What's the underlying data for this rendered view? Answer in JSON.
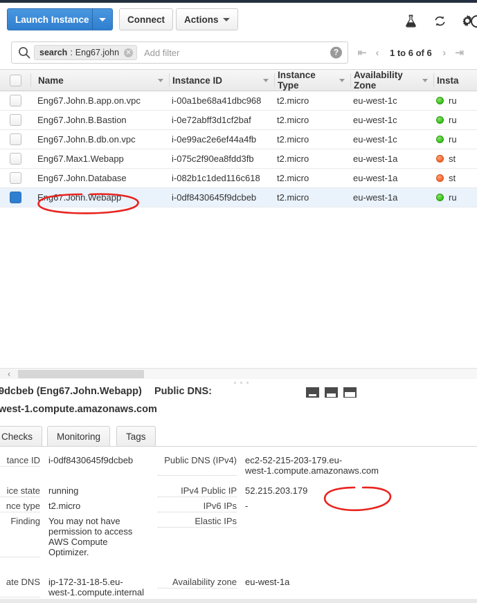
{
  "toolbar": {
    "launch_label": "Launch Instance",
    "launch_caret_icon": "caret-down-icon",
    "connect_label": "Connect",
    "actions_label": "Actions",
    "icons": [
      "flask-icon",
      "refresh-icon",
      "gear-icon",
      "help-circle-icon"
    ]
  },
  "filter": {
    "search_icon": "search-icon",
    "token_key": "search",
    "token_sep": ":",
    "token_value": "Eng67.john",
    "token_clear_icon": "close-icon",
    "placeholder": "Add filter",
    "help_icon": "question-mark-icon",
    "help_label": "?",
    "pagination": {
      "first_label": "|<",
      "prev_label": "<",
      "count_label": "1 to 6 of 6",
      "next_label": ">",
      "last_label": ">|"
    }
  },
  "table": {
    "columns": [
      {
        "label": "Name",
        "key": "name"
      },
      {
        "label": "Instance ID",
        "key": "id"
      },
      {
        "label": "Instance Type",
        "key": "type"
      },
      {
        "label": "Availability Zone",
        "key": "az"
      },
      {
        "label": "Insta",
        "key": "state"
      }
    ],
    "rows": [
      {
        "selected": false,
        "name": "Eng67.John.B.app.on.vpc",
        "id": "i-00a1be68a41dbc968",
        "type": "t2.micro",
        "az": "eu-west-1c",
        "state": "ru",
        "state_color": "green"
      },
      {
        "selected": false,
        "name": "Eng67.John.B.Bastion",
        "id": "i-0e72abff3d1cf2baf",
        "type": "t2.micro",
        "az": "eu-west-1c",
        "state": "ru",
        "state_color": "green"
      },
      {
        "selected": false,
        "name": "Eng67.John.B.db.on.vpc",
        "id": "i-0e99ac2e6ef44a4fb",
        "type": "t2.micro",
        "az": "eu-west-1c",
        "state": "ru",
        "state_color": "green"
      },
      {
        "selected": false,
        "name": "Eng67.Max1.Webapp",
        "id": "i-075c2f90ea8fdd3fb",
        "type": "t2.micro",
        "az": "eu-west-1a",
        "state": "st",
        "state_color": "orange"
      },
      {
        "selected": false,
        "name": "Eng67.John.Database",
        "id": "i-082b1c1ded116c618",
        "type": "t2.micro",
        "az": "eu-west-1a",
        "state": "st",
        "state_color": "orange"
      },
      {
        "selected": true,
        "name": "Eng67.John.Webapp",
        "id": "i-0df8430645f9dcbeb",
        "type": "t2.micro",
        "az": "eu-west-1a",
        "state": "ru",
        "state_color": "green"
      }
    ]
  },
  "scrollbar": {
    "left_chevron_icon": "chevron-left-icon",
    "left_chevron_label": "‹"
  },
  "detail": {
    "title": "9dcbeb (Eng67.John.Webapp)",
    "subtitle": "west-1.compute.amazonaws.com",
    "public_dns_label": "Public DNS:",
    "panel_size_icons": [
      "panel-small-icon",
      "panel-medium-icon",
      "panel-large-icon"
    ],
    "tabs": [
      {
        "label": "Checks"
      },
      {
        "label": "Monitoring"
      },
      {
        "label": "Tags"
      }
    ],
    "left_fields": [
      {
        "label": "tance ID",
        "value": [
          "i-0df8430645f9dcbeb"
        ]
      },
      {
        "label": "ice state",
        "value": [
          "running"
        ]
      },
      {
        "label": "nce type",
        "value": [
          "t2.micro"
        ]
      },
      {
        "label": "Finding",
        "value": [
          "You may not have",
          "permission to access",
          "AWS Compute",
          "Optimizer."
        ]
      },
      {
        "label": "ate DNS",
        "value": [
          "ip-172-31-18-5.eu-",
          "west-1.compute.internal"
        ]
      }
    ],
    "right_fields": [
      {
        "label": "Public DNS (IPv4)",
        "value": [
          "ec2-52-215-203-179.eu-",
          "west-1.compute.amazonaws.com"
        ]
      },
      {
        "label": "IPv4 Public IP",
        "value": [
          "52.215.203.179"
        ]
      },
      {
        "label": "IPv6 IPs",
        "value": [
          "-"
        ]
      },
      {
        "label": "Elastic IPs",
        "value": [
          ""
        ]
      },
      {
        "label": "Availability zone",
        "value": [
          "eu-west-1a"
        ]
      }
    ]
  },
  "annotations": {
    "color": "#e8231f",
    "items": [
      {
        "name": "circled-instance-name",
        "target": "Eng67.John.Webapp"
      },
      {
        "name": "circled-ipv4-public-ip",
        "target": "52.215.203.179"
      }
    ]
  }
}
